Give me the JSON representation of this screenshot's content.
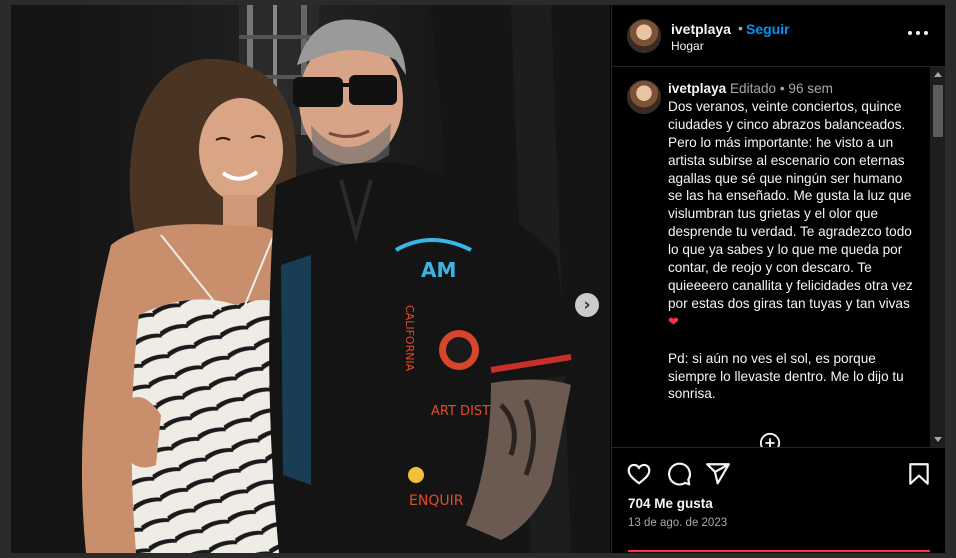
{
  "post": {
    "username": "ivetplaya",
    "follow_label": "Seguir",
    "separator": "•",
    "location": "Hogar"
  },
  "caption": {
    "username": "ivetplaya",
    "edited_label": "Editado",
    "separator": "•",
    "time": "96 sem",
    "body": "Dos veranos, veinte conciertos, quince ciudades y cinco abrazos balanceados. Pero lo más importante: he visto a un artista subirse al escenario con eternas agallas que sé que ningún ser humano se las ha enseñado. Me gusta la luz que vislumbran tus grietas y el olor que desprende tu verdad. Te agradezco todo lo que ya sabes y lo que me queda por contar, de reojo y con descaro. Te quieeeero canallita y felicidades otra vez por estas dos giras tan tuyas y tan vivas",
    "emoji": "❤",
    "body2": "Pd: si aún no ves el sol, es porque siempre lo llevaste dentro. Me lo dijo tu sonrisa."
  },
  "footer": {
    "likes": "704 Me gusta",
    "date": "13 de ago. de 2023"
  },
  "icons": {
    "more": "more-options-icon",
    "like": "heart-icon",
    "comment": "comment-icon",
    "share": "share-icon",
    "save": "bookmark-icon",
    "add_comment": "plus-circle-icon",
    "next": "chevron-right-icon"
  },
  "colors": {
    "background": "#000000",
    "link": "#0095f6",
    "text": "#f5f5f5",
    "muted": "#a8a8a8",
    "heart": "#ff3040"
  },
  "photo": {
    "shirt_text_1": "AM",
    "shirt_text_2": "CALIFORNIA",
    "shirt_text_3": "ART DISTRICT",
    "shirt_text_4": "ENQUIR"
  }
}
